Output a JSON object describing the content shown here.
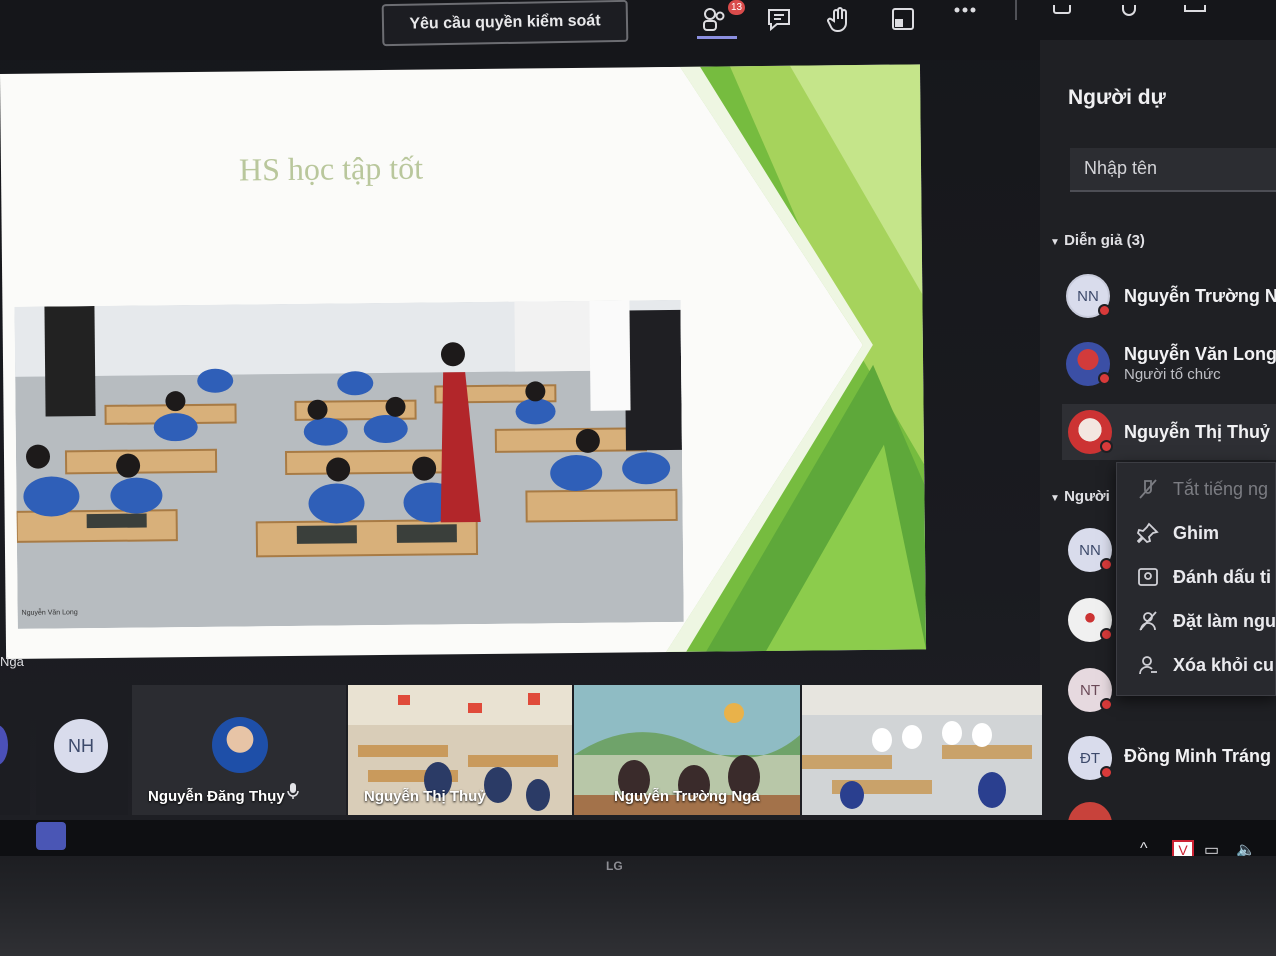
{
  "toolbar": {
    "request_control_label": "Yêu cầu quyền kiểm soát",
    "participants_badge": "13",
    "icons": [
      "participants-icon",
      "chat-icon",
      "raise-hand-icon",
      "rooms-icon",
      "more-icon",
      "camera-icon",
      "mic-icon",
      "share-icon"
    ]
  },
  "slide": {
    "title": "HS học tập tốt",
    "video_caption": "Nguyễn Văn Long",
    "accent_colors": [
      "#7cc04a",
      "#a8d65e",
      "#56a83a",
      "#c7e68c"
    ]
  },
  "people_panel": {
    "title": "Người dự",
    "search_placeholder": "Nhập tên",
    "presenters_header": "Diễn giả (3)",
    "attendees_header": "Người",
    "presenters": [
      {
        "initials": "NN",
        "name": "Nguyễn Trường N",
        "subtitle": ""
      },
      {
        "initials": "",
        "name": "Nguyễn Văn Long",
        "subtitle": "Người tổ chức"
      },
      {
        "initials": "",
        "name": "Nguyễn Thị Thuỷ",
        "subtitle": ""
      }
    ],
    "attendees": [
      {
        "initials": "NN",
        "name": ""
      },
      {
        "initials": "",
        "name": ""
      },
      {
        "initials": "NT",
        "name": ""
      },
      {
        "initials": "ĐT",
        "name": "Đồng Minh Tráng"
      }
    ]
  },
  "context_menu": {
    "items": [
      {
        "label": "Tắt tiếng ng",
        "icon": "mute-icon",
        "disabled": true
      },
      {
        "label": "Ghim",
        "icon": "pin-icon",
        "disabled": false
      },
      {
        "label": "Đánh dấu ti",
        "icon": "spotlight-icon",
        "disabled": false
      },
      {
        "label": "Đặt làm ngu",
        "icon": "make-attendee-icon",
        "disabled": false
      },
      {
        "label": "Xóa khỏi cu",
        "icon": "remove-icon",
        "disabled": false
      }
    ]
  },
  "video_strip": {
    "left_fragment": "Nga",
    "nh_initials": "NH",
    "tiles": [
      {
        "name": "Nguyễn Đăng Thụy"
      },
      {
        "name": "Nguyễn Thị Thuỷ"
      },
      {
        "name": "Nguyễn Trường Nga"
      },
      {
        "name": ""
      }
    ]
  },
  "monitor": {
    "brand": "LG"
  }
}
